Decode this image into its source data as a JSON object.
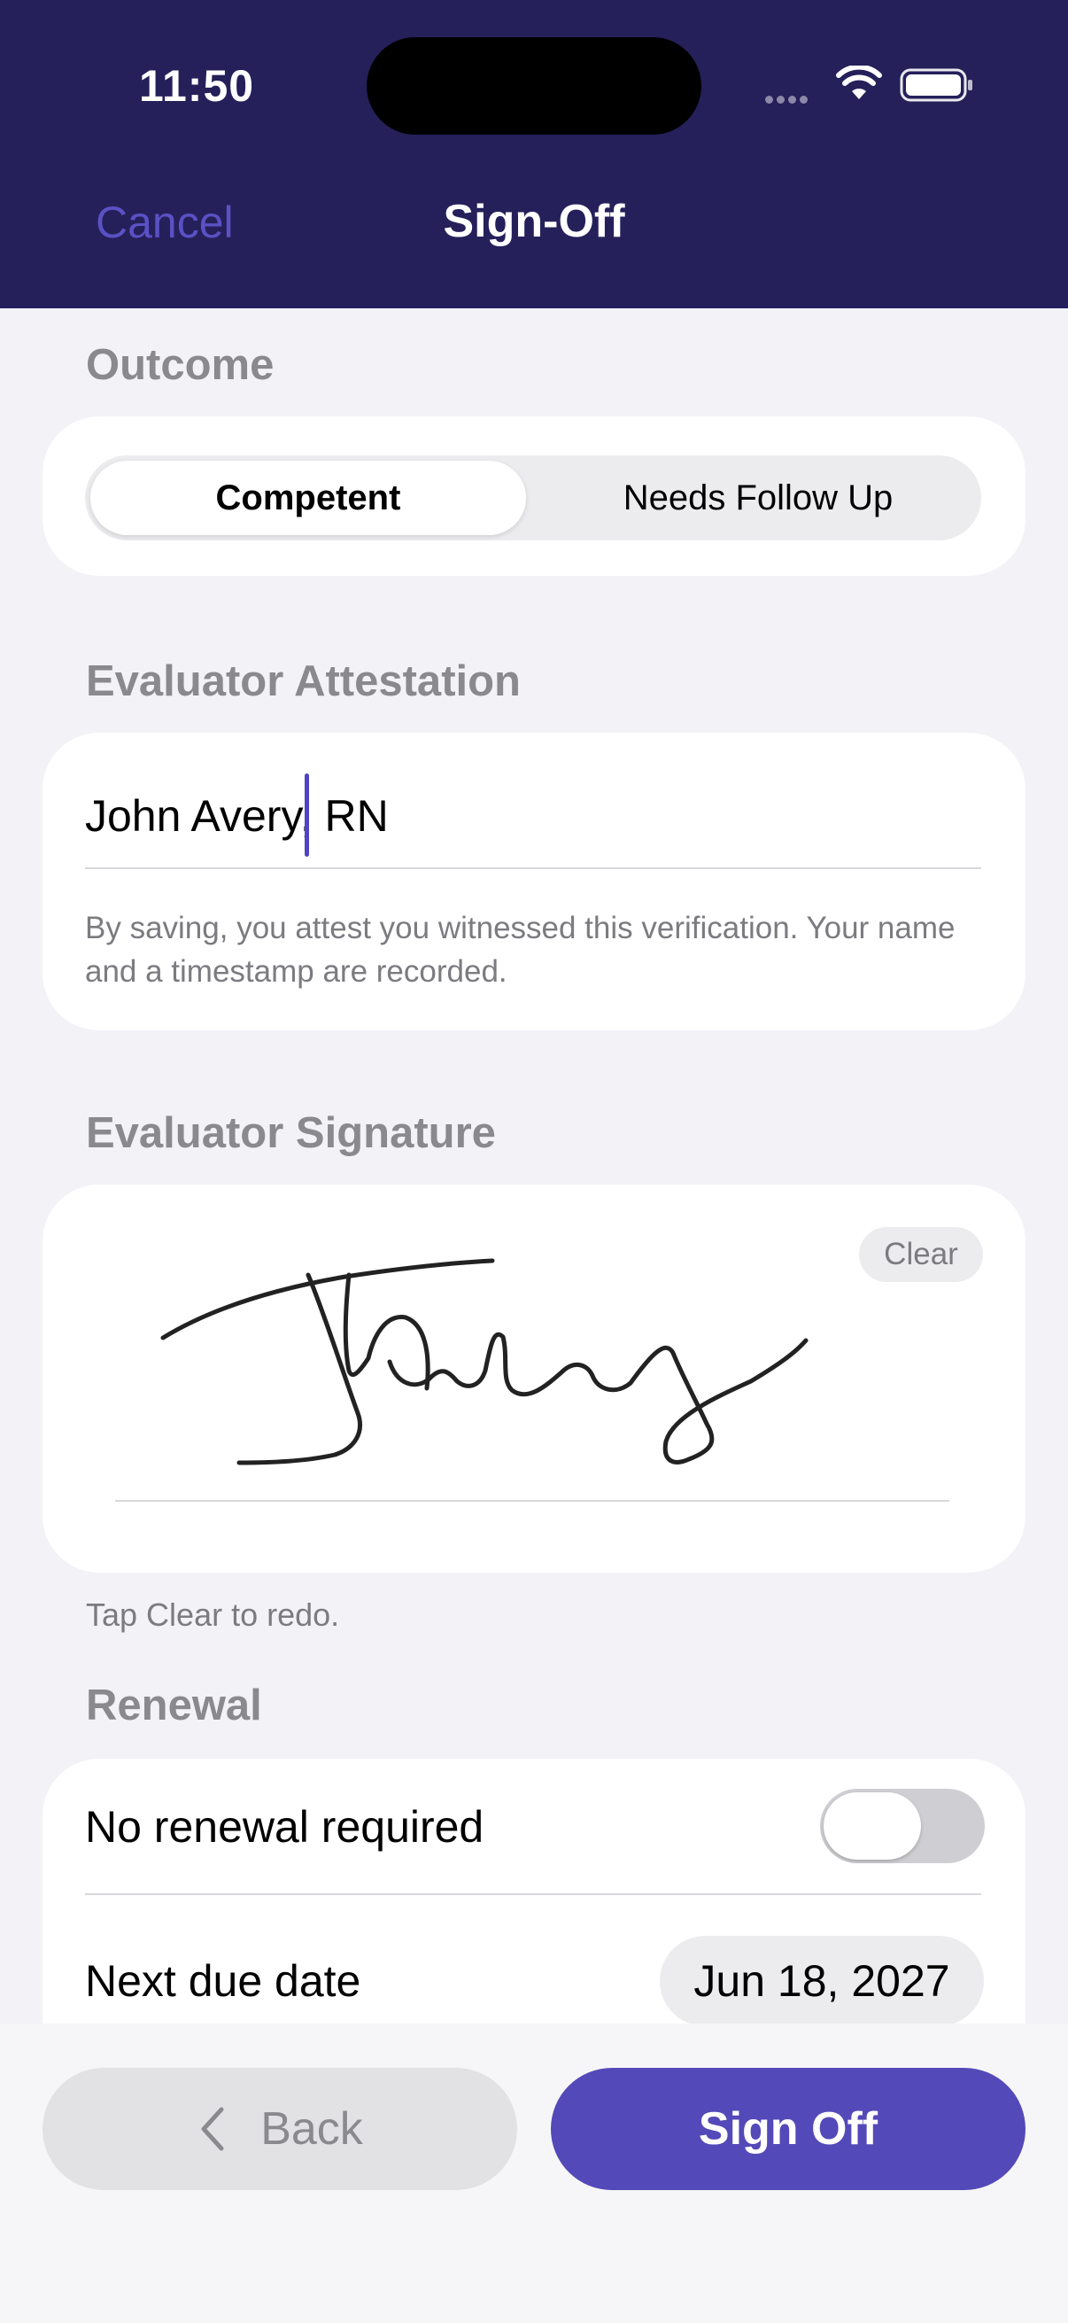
{
  "status_bar": {
    "time": "11:50"
  },
  "nav": {
    "cancel_label": "Cancel",
    "title": "Sign-Off"
  },
  "outcome": {
    "section_title": "Outcome",
    "options": [
      "Competent",
      "Needs Follow Up"
    ],
    "selected": "Competent"
  },
  "attestation": {
    "section_title": "Evaluator Attestation",
    "name_value": "John Avery, RN",
    "note": "By saving, you attest you witnessed this verification. Your name and a timestamp are recorded."
  },
  "signature": {
    "section_title": "Evaluator Signature",
    "clear_label": "Clear",
    "caption": "Tap Clear to redo."
  },
  "renewal": {
    "section_title": "Renewal",
    "no_renewal_label": "No renewal required",
    "no_renewal_on": false,
    "next_due_label": "Next due date",
    "next_due_value": "Jun 18, 2027"
  },
  "footer": {
    "back_label": "Back",
    "signoff_label": "Sign Off"
  },
  "colors": {
    "header_bg": "#25205a",
    "accent": "#5449b8",
    "page_bg": "#f2f2f7"
  }
}
